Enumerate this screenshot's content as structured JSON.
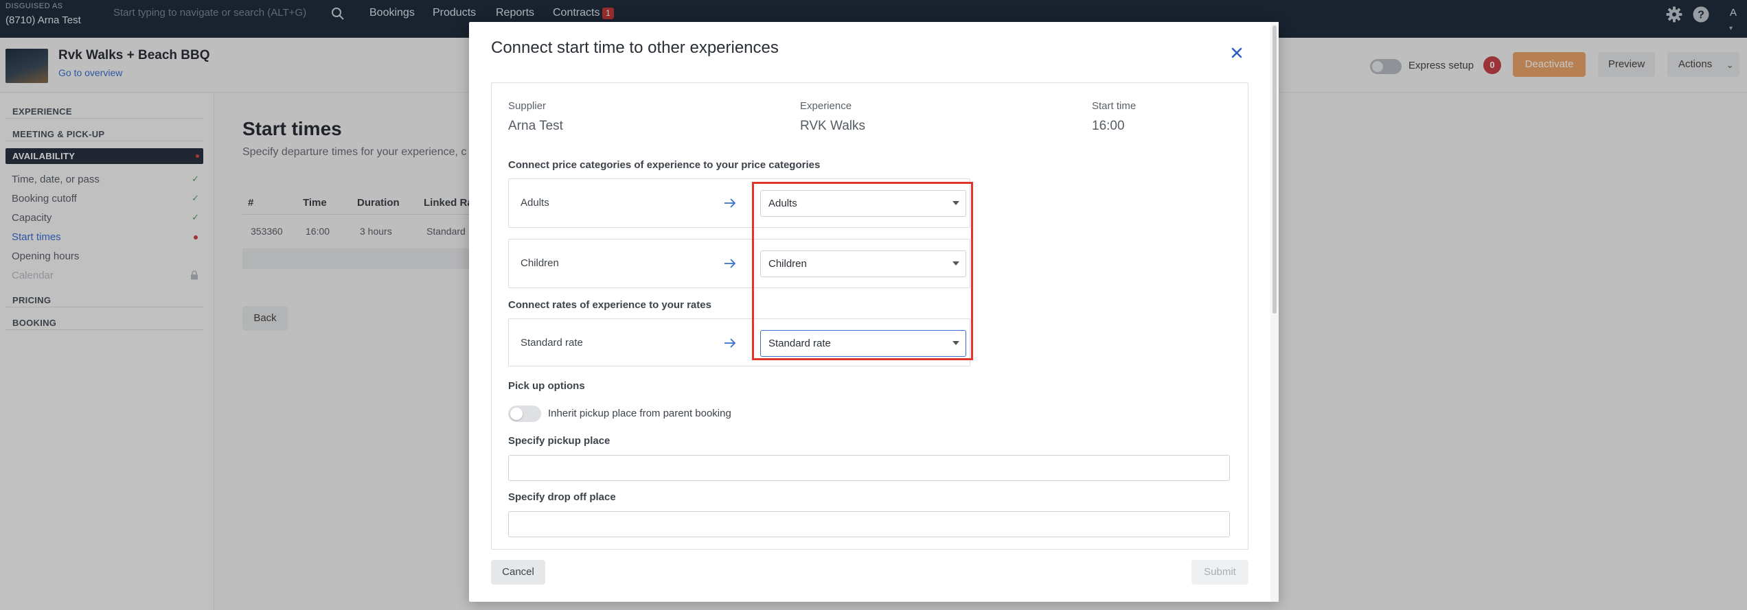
{
  "topbar": {
    "disguised_label": "DISGUISED AS",
    "account": "(8710) Arna Test",
    "search_placeholder": "Start typing to navigate or search (ALT+G)",
    "nav": [
      "Bookings",
      "Products",
      "Reports",
      "Contracts"
    ],
    "contracts_badge": "1",
    "avatar_initial": "A"
  },
  "header": {
    "product_title": "Rvk Walks + Beach BBQ",
    "overview_link": "Go to overview",
    "express_label": "Express setup",
    "alert_count": "0",
    "deactivate_label": "Deactivate",
    "preview_label": "Preview",
    "actions_label": "Actions"
  },
  "sidebar": {
    "sections": {
      "experience": "EXPERIENCE",
      "meeting": "MEETING & PICK-UP",
      "availability": "AVAILABILITY",
      "pricing": "PRICING",
      "booking": "BOOKING"
    },
    "items": [
      "Time, date, or pass",
      "Booking cutoff",
      "Capacity",
      "Start times",
      "Opening hours",
      "Calendar"
    ]
  },
  "main": {
    "title": "Start times",
    "subtitle": "Specify departure times for your experience, c",
    "columns": [
      "#",
      "Time",
      "Duration",
      "Linked Ra"
    ],
    "row": [
      "353360",
      "16:00",
      "3 hours",
      "Standard"
    ],
    "back_label": "Back"
  },
  "modal": {
    "title": "Connect start time to other experiences",
    "supplier_label": "Supplier",
    "supplier_value": "Arna Test",
    "experience_label": "Experience",
    "experience_value": "RVK Walks",
    "starttime_label": "Start time",
    "starttime_value": "16:00",
    "price_section": "Connect price categories of experience to your price categories",
    "price_rows": [
      {
        "name": "Adults",
        "selected": "Adults"
      },
      {
        "name": "Children",
        "selected": "Children"
      }
    ],
    "rates_section": "Connect rates of experience to your rates",
    "rate_rows": [
      {
        "name": "Standard rate",
        "selected": "Standard rate"
      }
    ],
    "pickup_section": "Pick up options",
    "inherit_label": "Inherit pickup place from parent booking",
    "pickup_label": "Specify pickup place",
    "pickup_value": "",
    "dropoff_label": "Specify drop off place",
    "dropoff_value": "",
    "cancel_label": "Cancel",
    "submit_label": "Submit"
  },
  "colors": {
    "topbar": "#1f2d3d",
    "accent_link": "#3a6fd0",
    "deactivate": "#e9a46a",
    "highlight": "#e0352b",
    "alert": "#c64348"
  }
}
